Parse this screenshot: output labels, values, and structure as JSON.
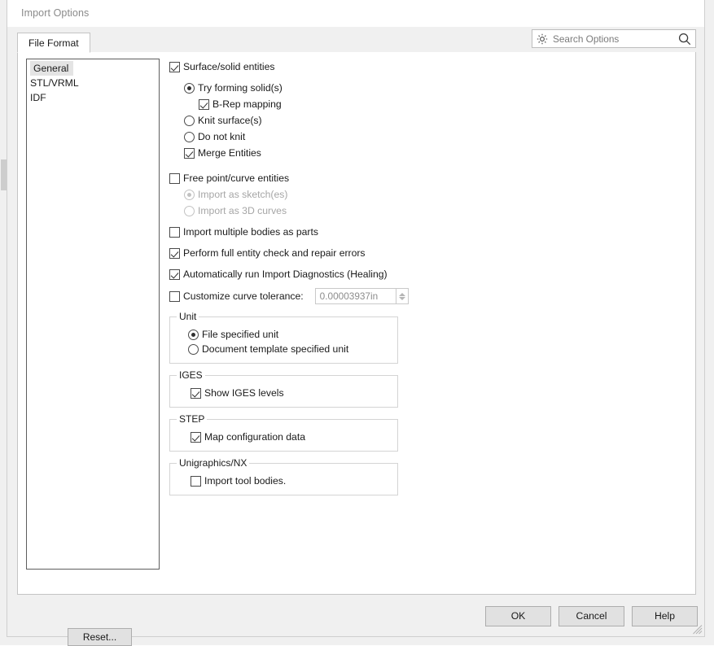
{
  "window": {
    "title": "Import Options"
  },
  "search": {
    "placeholder": "Search Options",
    "gear_icon": "gear-icon",
    "magnifier_icon": "search-icon"
  },
  "tabs": [
    {
      "label": "File Format",
      "active": true
    }
  ],
  "format_list": {
    "items": [
      {
        "label": "General",
        "selected": true
      },
      {
        "label": "STL/VRML",
        "selected": false
      },
      {
        "label": "IDF",
        "selected": false
      }
    ]
  },
  "options": {
    "surface_solid_entities": {
      "label": "Surface/solid entities",
      "checked": true,
      "enabled": true
    },
    "try_forming_solids": {
      "label": "Try forming solid(s)",
      "selected": true,
      "enabled": true
    },
    "brep_mapping": {
      "label": "B-Rep mapping",
      "checked": true,
      "enabled": true
    },
    "knit_surfaces": {
      "label": "Knit surface(s)",
      "selected": false,
      "enabled": true
    },
    "do_not_knit": {
      "label": "Do not knit",
      "selected": false,
      "enabled": true
    },
    "merge_entities": {
      "label": "Merge Entities",
      "checked": true,
      "enabled": true
    },
    "free_point_curve_entities": {
      "label": "Free point/curve entities",
      "checked": false,
      "enabled": true
    },
    "import_as_sketches": {
      "label": "Import as sketch(es)",
      "selected": true,
      "enabled": false
    },
    "import_as_3d_curves": {
      "label": "Import as 3D curves",
      "selected": false,
      "enabled": false
    },
    "import_multiple_bodies": {
      "label": "Import multiple bodies as parts",
      "checked": false,
      "enabled": true
    },
    "perform_full_entity_check": {
      "label": "Perform full entity check and repair errors",
      "checked": true,
      "enabled": true
    },
    "auto_run_diagnostics": {
      "label": "Automatically run Import Diagnostics (Healing)",
      "checked": true,
      "enabled": true
    },
    "customize_curve_tolerance": {
      "label": "Customize curve tolerance:",
      "checked": false,
      "enabled": true,
      "value": "0.00003937in"
    }
  },
  "groups": {
    "unit": {
      "title": "Unit",
      "file_specified": {
        "label": "File specified unit",
        "selected": true
      },
      "document_template": {
        "label": "Document template specified unit",
        "selected": false
      }
    },
    "iges": {
      "title": "IGES",
      "show_levels": {
        "label": "Show IGES levels",
        "checked": true
      }
    },
    "step": {
      "title": "STEP",
      "map_configuration_data": {
        "label": "Map configuration data",
        "checked": true
      }
    },
    "unigraphics": {
      "title": "Unigraphics/NX",
      "import_tool_bodies": {
        "label": "Import tool bodies.",
        "checked": false
      }
    }
  },
  "buttons": {
    "reset": "Reset...",
    "ok": "OK",
    "cancel": "Cancel",
    "help": "Help"
  },
  "colors": {
    "dialog_bg": "#f0f0f0",
    "panel_bg": "#ffffff",
    "button_bg": "#e1e1e1",
    "border": "#c4c4c4",
    "selection": "#e4e4e4",
    "disabled_text": "#a6a6a6"
  }
}
